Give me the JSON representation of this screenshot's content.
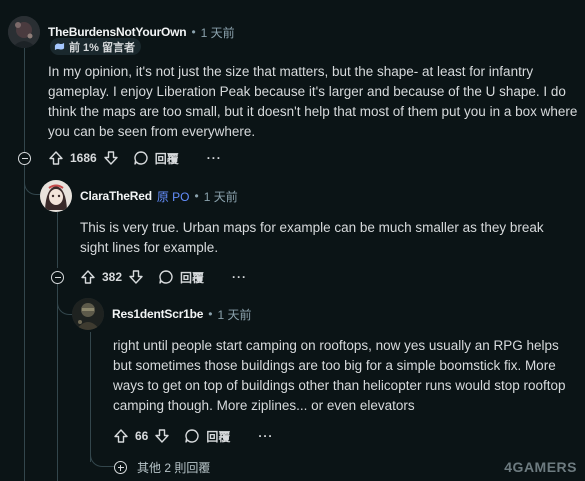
{
  "comments": [
    {
      "author": "TheBurdensNotYourOwn",
      "separator": "•",
      "time": "1 天前",
      "badge": "前 1% 留言者",
      "body": "In my opinion, it's not just the size that matters, but the shape- at least for infantry gameplay. I enjoy Liberation Peak because it's larger and because of the U shape. I do think the maps are too small, but it doesn't help that most of them put you in a box where you can be seen from everywhere.",
      "votes": "1686",
      "reply_label": "回覆",
      "more_label": "···"
    },
    {
      "author": "ClaraTheRed",
      "flair": "原 PO",
      "separator": "•",
      "time": "1 天前",
      "body": "This is very true. Urban maps for example can be much smaller as they break sight lines for example.",
      "votes": "382",
      "reply_label": "回覆",
      "more_label": "···"
    },
    {
      "author": "Res1dentScr1be",
      "separator": "•",
      "time": "1 天前",
      "body": "right until people start camping on rooftops, now yes usually an RPG helps but sometimes those buildings are too big for a simple boomstick fix. More ways to get on top of buildings other than helicopter runs would stop rooftop camping though. More ziplines... or even elevators",
      "votes": "66",
      "reply_label": "回覆",
      "more_label": "···"
    }
  ],
  "more_replies": "其他 2 則回覆",
  "watermark": "4GAMERS",
  "colors": {
    "background": "#0b1416",
    "text": "#d7dadc",
    "muted": "#8ba2ad",
    "op_flair": "#648efc",
    "thread_line": "#33464c"
  },
  "icons": [
    "upvote-icon",
    "downvote-icon",
    "comment-bubble-icon",
    "collapse-icon",
    "expand-icon",
    "badge-icon"
  ]
}
